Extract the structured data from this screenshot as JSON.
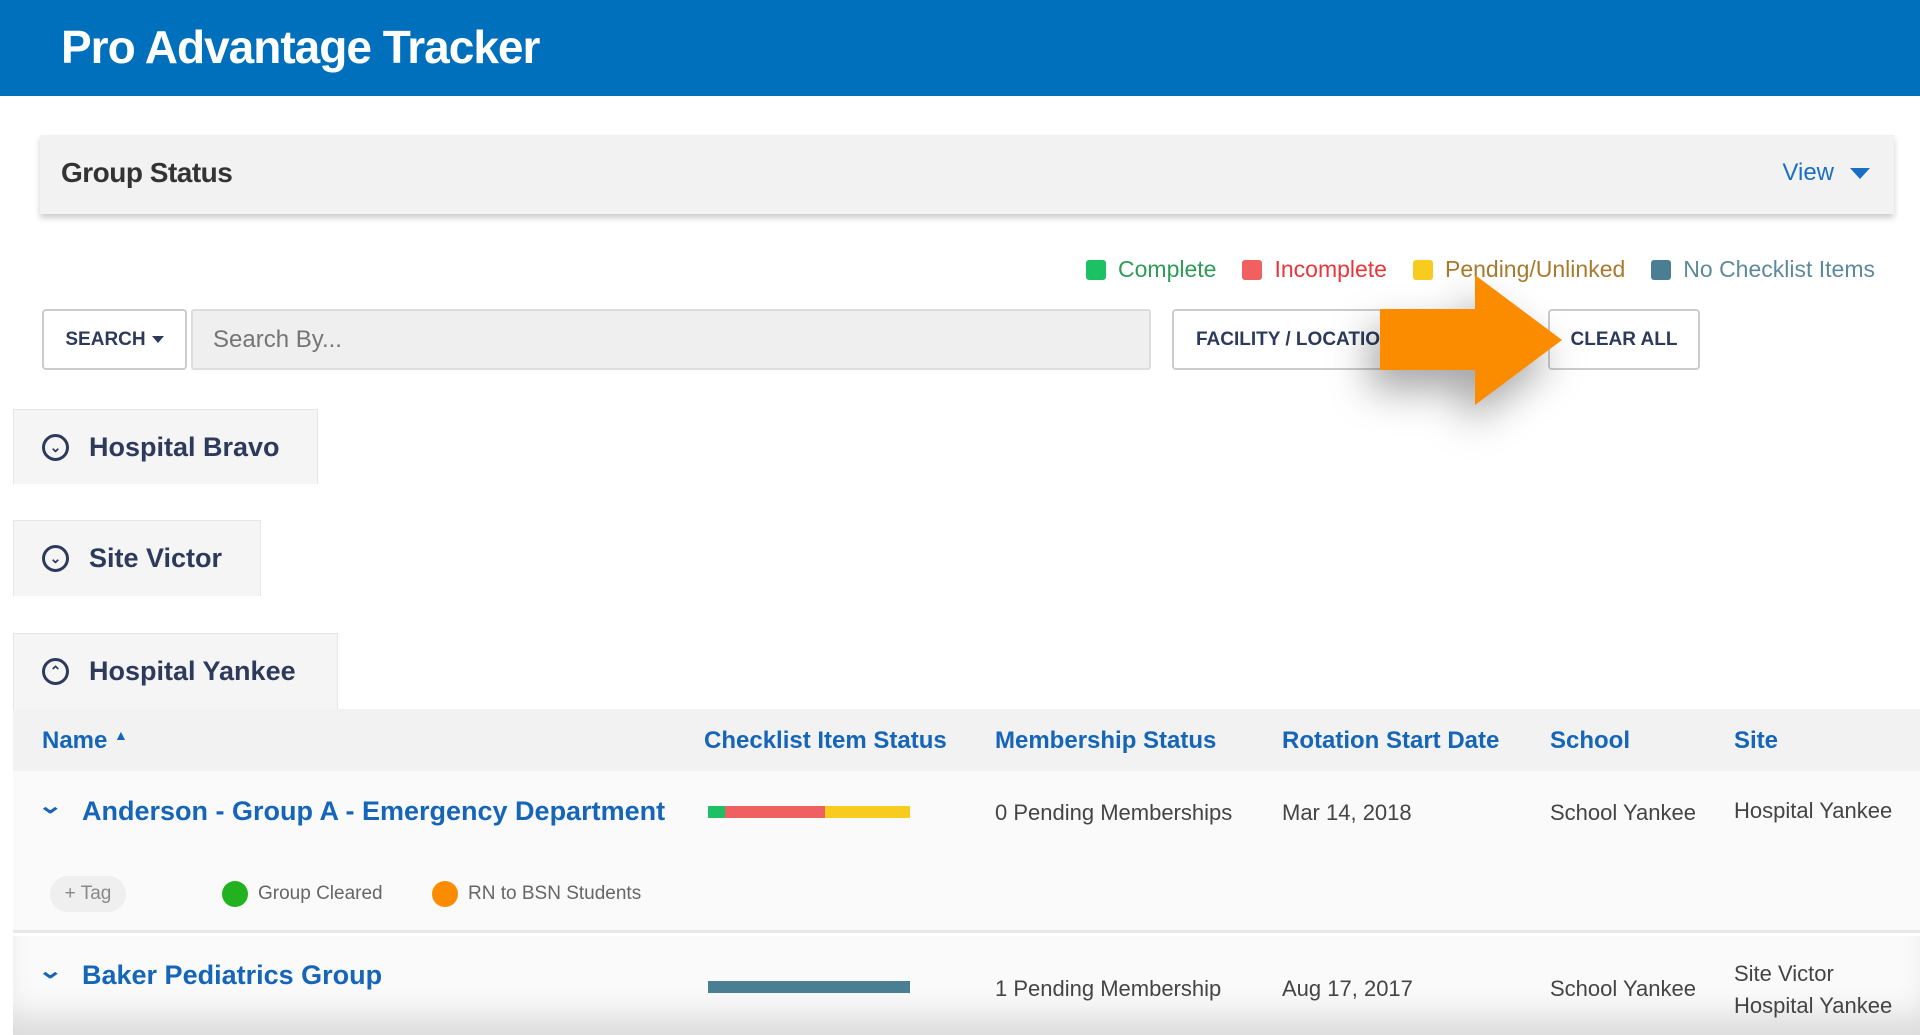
{
  "app": {
    "title": "Pro Advantage Tracker"
  },
  "group_status": {
    "title": "Group Status",
    "view_label": "View"
  },
  "legend": [
    {
      "label": "Complete",
      "color": "#1cc163",
      "text_color": "#2e9c57"
    },
    {
      "label": "Incomplete",
      "color": "#f06061",
      "text_color": "#e8363b"
    },
    {
      "label": "Pending/Unlinked",
      "color": "#f7cc1e",
      "text_color": "#a87a2e"
    },
    {
      "label": "No Checklist Items",
      "color": "#4a7f93",
      "text_color": "#5d8a9b"
    }
  ],
  "toolbar": {
    "search_label": "SEARCH",
    "search_placeholder": "Search By...",
    "facility_label": "FACILITY / LOCATION",
    "clear_all_label": "CLEAR ALL"
  },
  "groups": [
    {
      "label": "Hospital Bravo"
    },
    {
      "label": "Site Victor"
    },
    {
      "label": "Hospital Yankee"
    }
  ],
  "table": {
    "columns": [
      "Name",
      "Checklist Item Status",
      "Membership Status",
      "Rotation Start Date",
      "School",
      "Site"
    ],
    "rows": [
      {
        "name": "Anderson - Group A - Emergency Department",
        "checklist": {
          "complete": 8.5,
          "incomplete": 49.4,
          "pending": 42.1,
          "none": 0
        },
        "membership": "0 Pending Memberships",
        "start": "Mar 14, 2018",
        "school": "School Yankee",
        "site": [
          "Hospital Yankee"
        ],
        "add_tag": "+ Tag",
        "tags": [
          {
            "label": "Group Cleared",
            "color": "#22b21f"
          },
          {
            "label": "RN to BSN Students",
            "color": "#fb8c00"
          }
        ]
      },
      {
        "name": "Baker Pediatrics Group",
        "checklist": {
          "complete": 0,
          "incomplete": 0,
          "pending": 0,
          "none": 100
        },
        "membership": "1 Pending Membership",
        "start": "Aug 17, 2017",
        "school": "School Yankee",
        "site": [
          "Site Victor",
          "Hospital Yankee"
        ]
      }
    ]
  },
  "annotation": {
    "arrow_color": "#fb8c00"
  }
}
